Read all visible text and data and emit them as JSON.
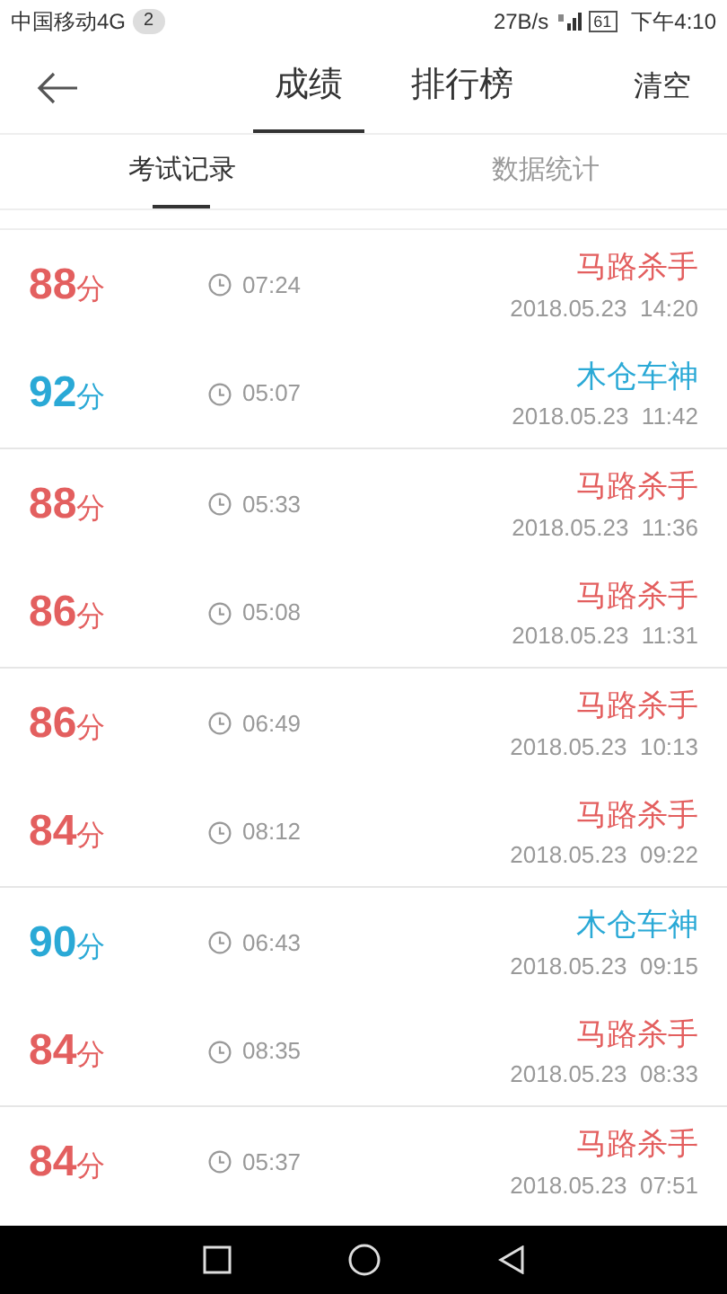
{
  "status_bar": {
    "carrier": "中国移动4G",
    "badge": "2",
    "speed": "27B/s",
    "battery": "61",
    "time": "下午4:10"
  },
  "header": {
    "tabs": [
      {
        "label": "成绩",
        "selected": true
      },
      {
        "label": "排行榜",
        "selected": false
      }
    ],
    "action": "清空"
  },
  "subtabs": [
    {
      "label": "考试记录",
      "selected": true
    },
    {
      "label": "数据统计",
      "selected": false
    }
  ],
  "records": [
    {
      "score": "88",
      "unit": "分",
      "duration": "07:24",
      "title": "马路杀手",
      "date": "2018.05.23  14:20",
      "color": "#e35f5f"
    },
    {
      "score": "92",
      "unit": "分",
      "duration": "05:07",
      "title": "木仓车神",
      "date": "2018.05.23  11:42",
      "color": "#2aa9d6"
    },
    {
      "score": "88",
      "unit": "分",
      "duration": "05:33",
      "title": "马路杀手",
      "date": "2018.05.23  11:36",
      "color": "#e35f5f"
    },
    {
      "score": "86",
      "unit": "分",
      "duration": "05:08",
      "title": "马路杀手",
      "date": "2018.05.23  11:31",
      "color": "#e35f5f"
    },
    {
      "score": "86",
      "unit": "分",
      "duration": "06:49",
      "title": "马路杀手",
      "date": "2018.05.23  10:13",
      "color": "#e35f5f"
    },
    {
      "score": "84",
      "unit": "分",
      "duration": "08:12",
      "title": "马路杀手",
      "date": "2018.05.23  09:22",
      "color": "#e35f5f"
    },
    {
      "score": "90",
      "unit": "分",
      "duration": "06:43",
      "title": "木仓车神",
      "date": "2018.05.23  09:15",
      "color": "#2aa9d6"
    },
    {
      "score": "84",
      "unit": "分",
      "duration": "08:35",
      "title": "马路杀手",
      "date": "2018.05.23  08:33",
      "color": "#e35f5f"
    },
    {
      "score": "84",
      "unit": "分",
      "duration": "05:37",
      "title": "马路杀手",
      "date": "2018.05.23  07:51",
      "color": "#e35f5f"
    }
  ]
}
